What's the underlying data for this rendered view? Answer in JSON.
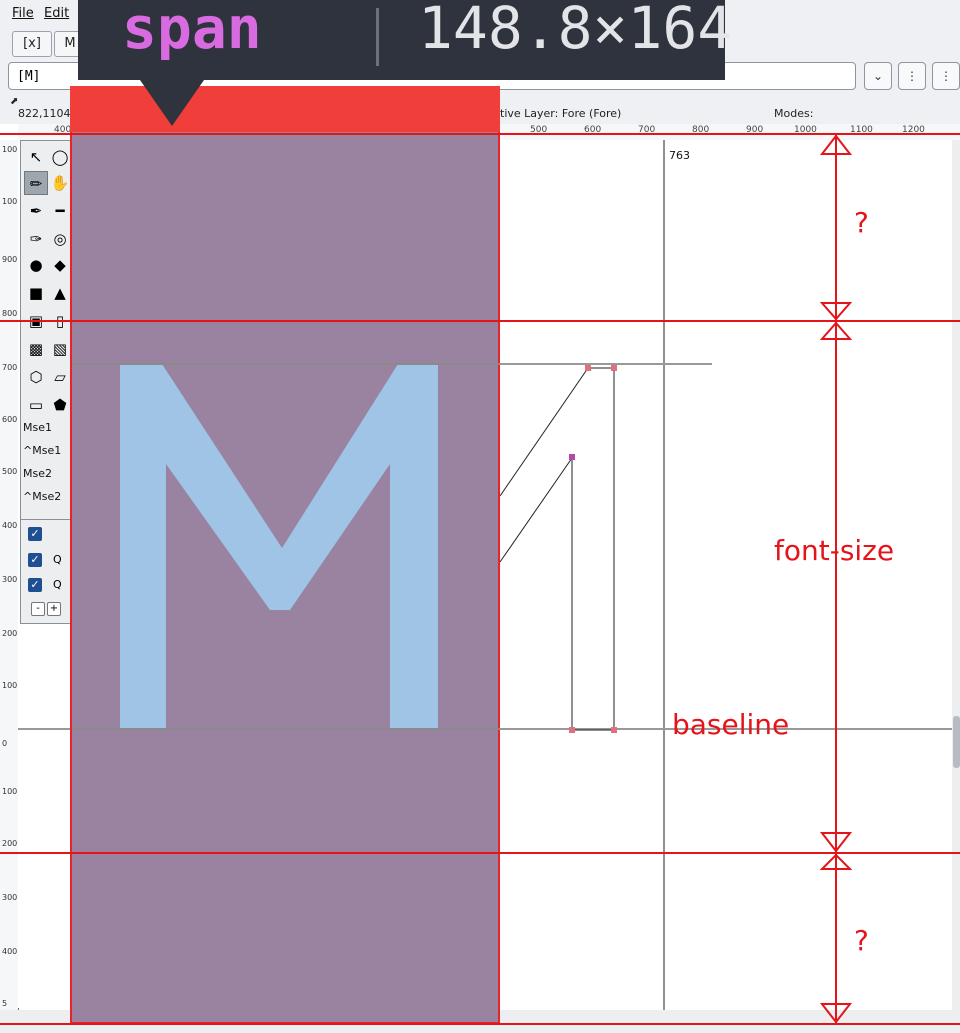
{
  "menu": {
    "file": "File",
    "edit": "Edit"
  },
  "tabs": {
    "close_tab": "[x]",
    "glyph_tab": "M"
  },
  "glyph_field": {
    "value": "[M]"
  },
  "status": {
    "coords": "822,1104",
    "active_layer": "tive Layer: Fore (Fore)",
    "modes": "Modes:"
  },
  "ruler": {
    "top_labels": [
      "400",
      "500",
      "600",
      "700",
      "800",
      "900",
      "1000",
      "1100",
      "1200"
    ],
    "left_labels": [
      "100",
      "100",
      "900",
      "800",
      "700",
      "600",
      "500",
      "400",
      "300",
      "200",
      "100",
      "0",
      "100",
      "200",
      "300",
      "400",
      "5"
    ]
  },
  "palette": {
    "mouse_labels": [
      "Mse1",
      "^Mse1",
      "Mse2",
      "^Mse2"
    ],
    "layer_labels": [
      "Q",
      "Q"
    ],
    "minus": "-",
    "plus": "+"
  },
  "canvas": {
    "advance_label": "763"
  },
  "tooltip": {
    "element": "span",
    "size": "148.8×164"
  },
  "annotations": {
    "top_question": "?",
    "font_size": "font-size",
    "baseline": "baseline",
    "bottom_question": "?"
  },
  "glyph": {
    "letter": "M"
  },
  "colors": {
    "annotation_red": "#e4141a",
    "overlay_purple": "#9a82a1",
    "glyph_blue": "#9fc4e6",
    "tooltip_dark": "#2f333d",
    "tooltip_pink": "#d96be0"
  }
}
